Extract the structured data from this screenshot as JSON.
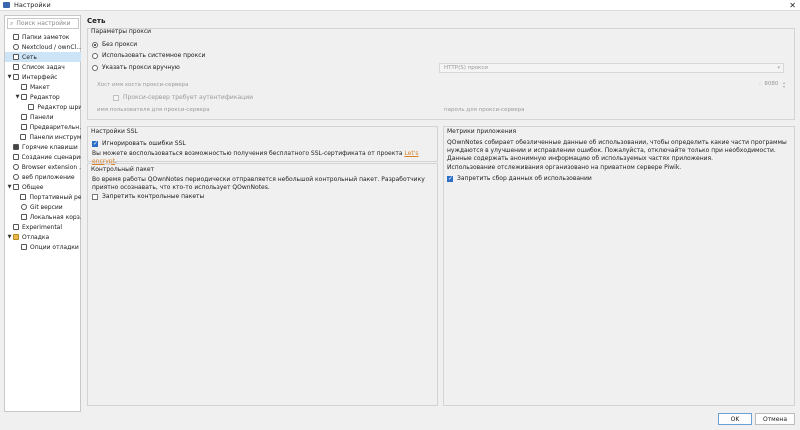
{
  "window": {
    "title": "Настройки",
    "close": "✕"
  },
  "sidebar": {
    "search_placeholder": "Поиск настройки",
    "items": [
      {
        "label": "Папки заметок",
        "arrow": ""
      },
      {
        "label": "Nextcloud / ownCl...",
        "arrow": ""
      },
      {
        "label": "Сеть",
        "arrow": ""
      },
      {
        "label": "Список задач",
        "arrow": ""
      },
      {
        "label": "Интерфейс",
        "arrow": "▼"
      },
      {
        "label": "Макет",
        "arrow": ""
      },
      {
        "label": "Редактор",
        "arrow": "▼"
      },
      {
        "label": "Редактор шри...",
        "arrow": ""
      },
      {
        "label": "Панели",
        "arrow": ""
      },
      {
        "label": "Предварительн...",
        "arrow": ""
      },
      {
        "label": "Панели инструм...",
        "arrow": ""
      },
      {
        "label": "Горячие клавиши",
        "arrow": ""
      },
      {
        "label": "Создание сценариев",
        "arrow": ""
      },
      {
        "label": "Browser extension ...",
        "arrow": ""
      },
      {
        "label": "веб приложение",
        "arrow": ""
      },
      {
        "label": "Общее",
        "arrow": "▼"
      },
      {
        "label": "Портативный ре...",
        "arrow": ""
      },
      {
        "label": "Git версии",
        "arrow": ""
      },
      {
        "label": "Локальная корз...",
        "arrow": ""
      },
      {
        "label": "Experimental",
        "arrow": ""
      },
      {
        "label": "Отладка",
        "arrow": "▼"
      },
      {
        "label": "Опции отладки",
        "arrow": ""
      }
    ]
  },
  "page": {
    "title": "Сеть"
  },
  "proxy": {
    "group_title": "Параметры прокси",
    "no_proxy": "Без прокси",
    "system_proxy": "Использовать системное прокси",
    "manual_proxy": "Указать прокси вручную",
    "proxy_type": "HTTP(S) прокси",
    "host_label": "Хост",
    "host_placeholder": "имя хоста прокси-сервера",
    "port_value": "8080",
    "auth_required": "Прокси-сервер требует аутентификации",
    "user_placeholder": "имя пользователя для прокси-сервера",
    "password_placeholder": "пароль для прокси-сервера"
  },
  "ssl": {
    "group_title": "Настройки SSL",
    "ignore_errors": "Игнорировать ошибки SSL",
    "info_prefix": "Вы можете воспользоваться возможностью получения бесплатного SSL-сертификата от проекта ",
    "info_link": "Let's encrypt",
    "info_suffix": "."
  },
  "heartbeat": {
    "group_title": "Контрольный пакет",
    "description": "Во время работы QOwnNotes периодически отправляется небольшой контрольный пакет. Разработчику приятно осознавать, что кто-то использует QOwnNotes.",
    "disable": "Запретить контрольные пакеты"
  },
  "metrics": {
    "group_title": "Метрики приложения",
    "description": "QOwnNotes собирает обезличенные данные об использовании, чтобы определить какие части программы нуждаются в улучшении и исправлении ошибок. Пожалуйста, отключайте только при необходимости.",
    "anonymous": "Данные содержать анонимную информацию об используемых частях приложения.",
    "piwik": "Использование отслеживания организовано на приватном сервере Piwik.",
    "disable": "Запретить сбор данных об использовании"
  },
  "buttons": {
    "ok": "OK",
    "cancel": "Отмена"
  }
}
